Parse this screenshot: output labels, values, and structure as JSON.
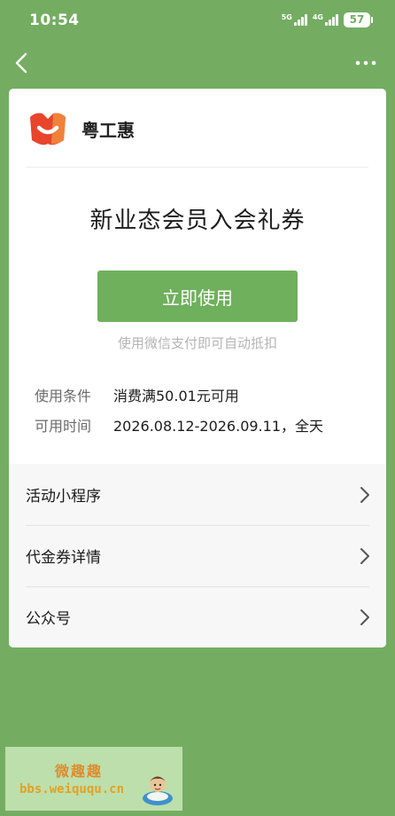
{
  "status_bar": {
    "time": "10:54",
    "network_5g": "5G",
    "network_4g": "4G",
    "battery": "57"
  },
  "nav": {
    "back_icon": "chevron-left-icon",
    "more_icon": "more-horizontal-icon"
  },
  "brand": {
    "name": "粤工惠",
    "logo_colors": [
      "#e8452c",
      "#f08a3a"
    ]
  },
  "coupon": {
    "title": "新业态会员入会礼券",
    "use_button_label": "立即使用",
    "hint": "使用微信支付即可自动抵扣",
    "details": [
      {
        "label": "使用条件",
        "value": "消费满50.01元可用"
      },
      {
        "label": "可用时间",
        "value": "2026.08.12-2026.09.11，全天"
      }
    ]
  },
  "links": [
    {
      "label": "活动小程序",
      "icon": "chevron-right-icon"
    },
    {
      "label": "代金券详情",
      "icon": "chevron-right-icon"
    },
    {
      "label": "公众号",
      "icon": "chevron-right-icon"
    }
  ],
  "watermark": {
    "title": "微趣趣",
    "url": "bbs.weiququ.cn"
  },
  "colors": {
    "background": "#74ad62",
    "accent": "#6fb05c",
    "card": "#ffffff"
  }
}
